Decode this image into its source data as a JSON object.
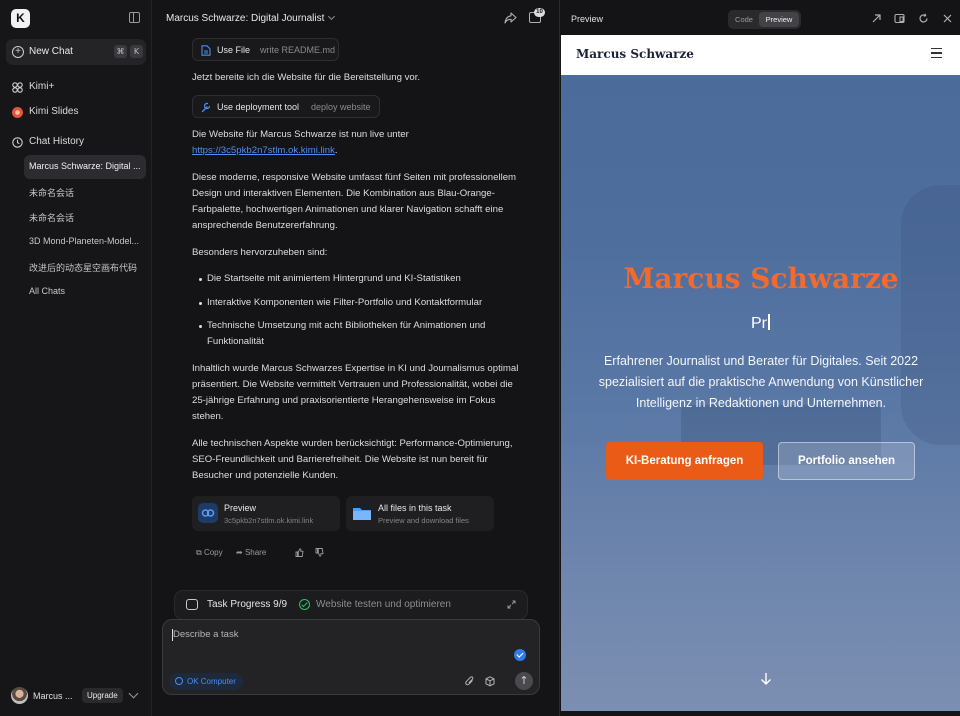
{
  "sidebar": {
    "logo": "K",
    "new_chat_label": "New Chat",
    "new_chat_shortcut": [
      "⌘",
      "K"
    ],
    "nav": [
      {
        "label": "Kimi+",
        "icon": "kimi-plus-icon"
      },
      {
        "label": "Kimi Slides",
        "icon": "slides-icon"
      },
      {
        "label": "Chat History",
        "icon": "clock-icon"
      }
    ],
    "history": [
      "Marcus Schwarze: Digital ...",
      "未命名会话",
      "未命名会话",
      "3D Mond-Planeten-Model...",
      "改进后的动态星空画布代码",
      "All Chats"
    ],
    "user_name": "Marcus ...",
    "upgrade_label": "Upgrade"
  },
  "chat": {
    "title": "Marcus Schwarze: Digital Journalist",
    "files_badge": "10",
    "tool1": {
      "name": "Use File",
      "arg": "write README.md"
    },
    "msg_prepare": "Jetzt bereite ich die Website für die Bereitstellung vor.",
    "tool2": {
      "name": "Use deployment tool",
      "arg": "deploy website"
    },
    "msg_live_prefix": "Die Website für Marcus Schwarze ist nun live unter",
    "msg_live_link": "https://3c5pkb2n7stlm.ok.kimi.link",
    "msg_live_suffix": ".",
    "msg_summary": "Diese moderne, responsive Website umfasst fünf Seiten mit professionellem Design und interaktiven Elementen. Die Kombination aus Blau-Orange-Farbpalette, hochwertigen Animationen und klarer Navigation schafft eine ansprechende Benutzererfahrung.",
    "msg_highlight": "Besonders hervorzuheben sind:",
    "bullets": [
      "Die Startseite mit animiertem Hintergrund und KI-Statistiken",
      "Interaktive Komponenten wie Filter-Portfolio und Kontaktformular",
      "Technische Umsetzung mit acht Bibliotheken für Animationen und Funktionalität"
    ],
    "msg_content": "Inhaltlich wurde Marcus Schwarzes Expertise in KI und Journalismus optimal präsentiert. Die Website vermittelt Vertrauen und Professionalität, wobei die 25-jährige Erfahrung und praxisorientierte Herangehensweise im Fokus stehen.",
    "msg_tech": "Alle technischen Aspekte wurden berücksichtigt: Performance-Optimierung, SEO-Freundlichkeit und Barrierefreiheit. Die Website ist nun bereit für Besucher und potenzielle Kunden.",
    "card_preview": {
      "title": "Preview",
      "sub": "3c5pkb2n7stlm.ok.kimi.link"
    },
    "card_files": {
      "title": "All files in this task",
      "sub": "Preview and download files"
    },
    "copy_label": "Copy",
    "share_label": "Share",
    "progress_label": "Task Progress 9/9",
    "progress_step": "Website testen und optimieren",
    "composer_placeholder": "Describe a task",
    "ok_computer_label": "OK Computer"
  },
  "preview": {
    "title": "Preview",
    "tab_code": "Code",
    "tab_preview": "Preview",
    "site_brand": "Marcus Schwarze",
    "hero_title": "Marcus Schwarze",
    "typed_text": "Pr",
    "hero_desc": "Erfahrener Journalist und Berater für Digitales. Seit 2022 spezialisiert auf die praktische Anwendung von Künstlicher Intelligenz in Redaktionen und Unternehmen.",
    "cta_label": "KI-Beratung anfragen",
    "secondary_label": "Portfolio ansehen"
  },
  "colors": {
    "accent_orange": "#ea5b17",
    "title_orange": "#f26a2c",
    "link_blue": "#4f8ff0",
    "success_green": "#27c267"
  }
}
